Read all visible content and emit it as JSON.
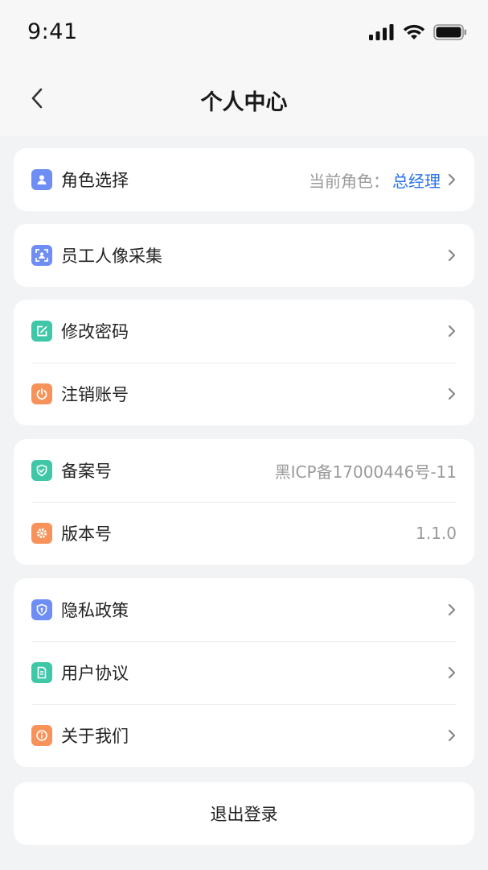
{
  "status_bar": {
    "time": "9:41"
  },
  "header": {
    "title": "个人中心"
  },
  "colors": {
    "accent": "#2a73e8",
    "blue_icon": "#6e8ef5",
    "teal_icon": "#3fc7a8",
    "orange_icon": "#f7935a"
  },
  "role_card": {
    "label": "角色选择",
    "current_prefix": "当前角色：",
    "current_value": "总经理",
    "icon": "user-icon"
  },
  "face_card": {
    "label": "员工人像采集",
    "icon": "face-scan-icon"
  },
  "account_card": {
    "change_password": {
      "label": "修改密码",
      "icon": "edit-icon"
    },
    "deactivate": {
      "label": "注销账号",
      "icon": "power-icon"
    }
  },
  "info_card": {
    "icp": {
      "label": "备案号",
      "value": "黑ICP备17000446号-11",
      "icon": "shield-check-icon"
    },
    "version": {
      "label": "版本号",
      "value": "1.1.0",
      "icon": "gear-icon"
    }
  },
  "legal_card": {
    "privacy": {
      "label": "隐私政策",
      "icon": "shield-icon"
    },
    "agreement": {
      "label": "用户协议",
      "icon": "document-icon"
    },
    "about": {
      "label": "关于我们",
      "icon": "info-icon"
    }
  },
  "logout": {
    "label": "退出登录"
  }
}
